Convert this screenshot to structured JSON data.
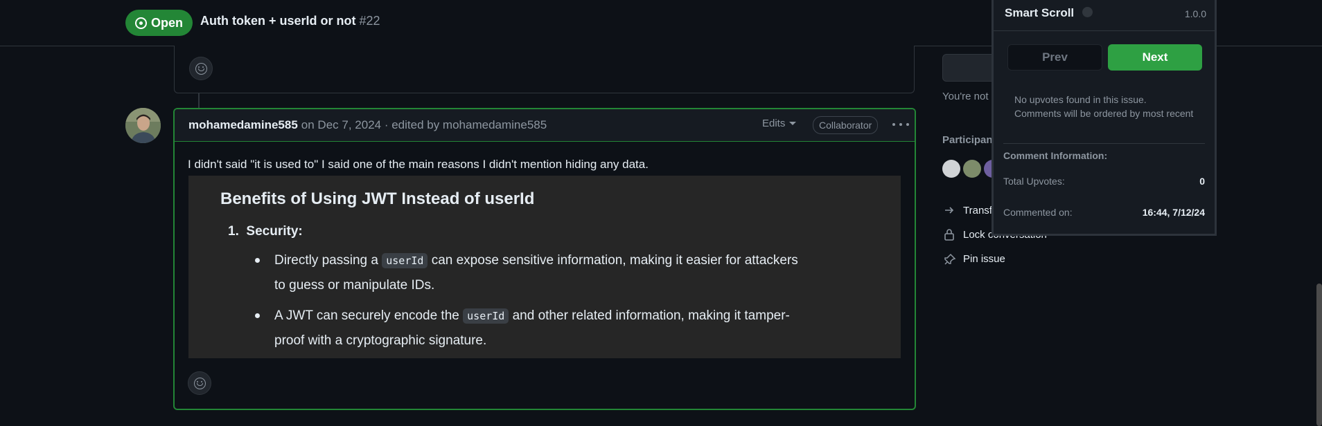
{
  "header": {
    "status_label": "Open",
    "title": "Auth token + userId or not",
    "number": "#22"
  },
  "comment": {
    "author": "mohamedamine585",
    "meta": "on Dec 7, 2024 · edited by mohamedamine585",
    "edits_label": "Edits",
    "role_badge": "Collaborator",
    "body_text": "I didn't said \"it is used to\" I said one of the main reasons I didn't mention hiding any data.",
    "quote": {
      "heading": "Benefits of Using JWT Instead of userId",
      "item_number": "1.",
      "item_title": "Security:",
      "bullet1_pre": "Directly passing a",
      "bullet1_code": "userId",
      "bullet1_post": "can expose sensitive information, making it easier for attackers",
      "bullet1_line2": "to guess or manipulate IDs.",
      "bullet2_pre": "A JWT can securely encode the",
      "bullet2_code": "userId",
      "bullet2_post": "and other related information, making it tamper-",
      "bullet2_line2": "proof with a cryptographic signature."
    }
  },
  "sidebar": {
    "not_text": "You're not",
    "participants_label": "Participant",
    "transfer_label": "Transf",
    "lock_label": "Lock conversation",
    "pin_label": "Pin issue"
  },
  "smart_scroll": {
    "title": "Smart Scroll",
    "version": "1.0.0",
    "prev_label": "Prev",
    "next_label": "Next",
    "message": "No upvotes found in this issue. Comments will be ordered by most recent",
    "section_title": "Comment Information:",
    "total_upvotes_label": "Total Upvotes:",
    "total_upvotes_value": "0",
    "commented_on_label": "Commented on:",
    "commented_on_value": "16:44, 7/12/24"
  },
  "colors": {
    "open_green": "#238636",
    "next_green": "#2ea043",
    "page_bg": "#0d1117"
  },
  "icons": [
    "issue-opened-icon",
    "smiley-icon",
    "kebab-menu-icon",
    "caret-down-icon",
    "arrow-right-icon",
    "lock-icon",
    "pin-icon",
    "github-icon"
  ]
}
